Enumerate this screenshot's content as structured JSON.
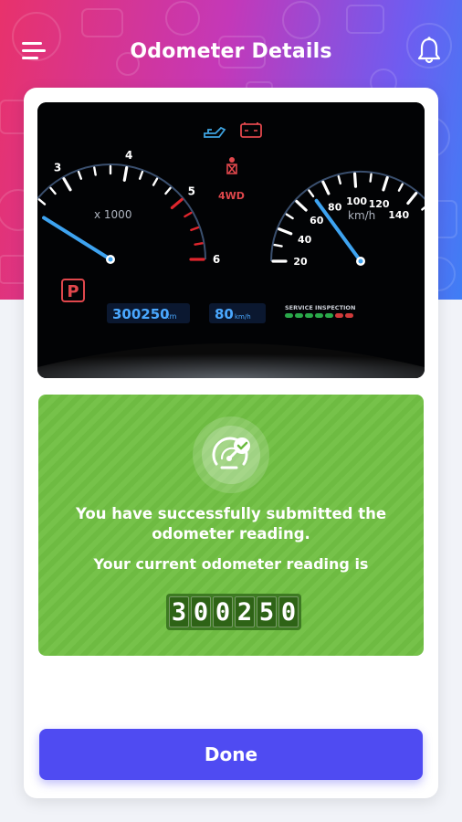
{
  "header": {
    "title": "Odometer Details",
    "menu_icon": "hamburger-menu-icon",
    "notification_icon": "bell-icon"
  },
  "dashboard": {
    "tach_labels": [
      "3",
      "4",
      "5",
      "6"
    ],
    "tach_unit": "x 1000",
    "tach_needle_rpm_thousands": 2.3,
    "speed_labels": [
      "20",
      "40",
      "60",
      "80",
      "100",
      "120",
      "140"
    ],
    "speed_unit": "km/h",
    "speed_needle_kmh": 70,
    "gear": "P",
    "drive_mode": "4WD",
    "odometer_display": "300250",
    "odometer_unit": "km",
    "speed_display": "80",
    "speed_display_unit": "km/h",
    "service_label": "SERVICE INSPECTION",
    "service_lights": [
      "#2aa84a",
      "#2aa84a",
      "#2aa84a",
      "#2aa84a",
      "#2aa84a",
      "#d03a3a",
      "#d03a3a"
    ],
    "warning_icons": [
      "oil-can-icon",
      "battery-icon",
      "seatbelt-icon"
    ]
  },
  "success": {
    "icon": "speedometer-check-icon",
    "message": "You have successfully submitted the odometer reading.",
    "reading_label": "Your current odometer reading is",
    "reading_digits": [
      "3",
      "0",
      "0",
      "2",
      "5",
      "0"
    ]
  },
  "actions": {
    "done_label": "Done"
  },
  "colors": {
    "primary": "#4f4bf2",
    "success_green": "#72be46",
    "header_gradient": [
      "#e8326b",
      "#c438b8",
      "#6f5cf0",
      "#3f7ef5"
    ]
  }
}
